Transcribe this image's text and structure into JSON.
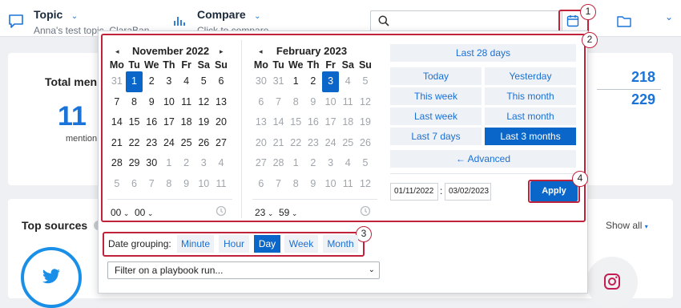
{
  "header": {
    "topic_label": "Topic",
    "topic_value": "Anna's test topic ,ClaraBan",
    "compare_label": "Compare",
    "compare_placeholder": "Click to compare",
    "search_placeholder": ""
  },
  "background": {
    "total_label": "Total men",
    "big_number": "11",
    "mentions_label": "mention",
    "stat_1": "218",
    "stat_2": "229",
    "top_sources_label": "Top sources",
    "show_all_label": "Show all"
  },
  "calendar_left": {
    "title": "November 2022",
    "dow": [
      "Mo",
      "Tu",
      "We",
      "Th",
      "Fr",
      "Sa",
      "Su"
    ],
    "days": [
      [
        "31",
        "1",
        "2",
        "3",
        "4",
        "5",
        "6"
      ],
      [
        "7",
        "8",
        "9",
        "10",
        "11",
        "12",
        "13"
      ],
      [
        "14",
        "15",
        "16",
        "17",
        "18",
        "19",
        "20"
      ],
      [
        "21",
        "22",
        "23",
        "24",
        "25",
        "26",
        "27"
      ],
      [
        "28",
        "29",
        "30",
        "1",
        "2",
        "3",
        "4"
      ],
      [
        "5",
        "6",
        "7",
        "8",
        "9",
        "10",
        "11"
      ]
    ],
    "hour": "00",
    "minute": "00"
  },
  "calendar_right": {
    "title": "February 2023",
    "dow": [
      "Mo",
      "Tu",
      "We",
      "Th",
      "Fr",
      "Sa",
      "Su"
    ],
    "days": [
      [
        "30",
        "31",
        "1",
        "2",
        "3",
        "4",
        "5"
      ],
      [
        "6",
        "7",
        "8",
        "9",
        "10",
        "11",
        "12"
      ],
      [
        "13",
        "14",
        "15",
        "16",
        "17",
        "18",
        "19"
      ],
      [
        "20",
        "21",
        "22",
        "23",
        "24",
        "25",
        "26"
      ],
      [
        "27",
        "28",
        "1",
        "2",
        "3",
        "4",
        "5"
      ],
      [
        "6",
        "7",
        "8",
        "9",
        "10",
        "11",
        "12"
      ]
    ],
    "hour": "23",
    "minute": "59"
  },
  "quick_ranges": {
    "last_28_days": "Last 28 days",
    "today": "Today",
    "yesterday": "Yesterday",
    "this_week": "This week",
    "this_month": "This month",
    "last_week": "Last week",
    "last_month": "Last month",
    "last_7_days": "Last 7 days",
    "last_3_months": "Last 3 months",
    "advanced": "← Advanced"
  },
  "range": {
    "start": "01/11/2022",
    "separator": ":",
    "end": "03/02/2023",
    "apply_label": "Apply"
  },
  "grouping": {
    "label": "Date grouping:",
    "options": [
      "Minute",
      "Hour",
      "Day",
      "Week",
      "Month"
    ],
    "selected": "Day"
  },
  "playbook_filter": "Filter on a playbook run...",
  "annotations": [
    "1",
    "2",
    "3",
    "4"
  ],
  "colors": {
    "accent": "#0a67c9",
    "annotation_red": "#c0223b"
  }
}
